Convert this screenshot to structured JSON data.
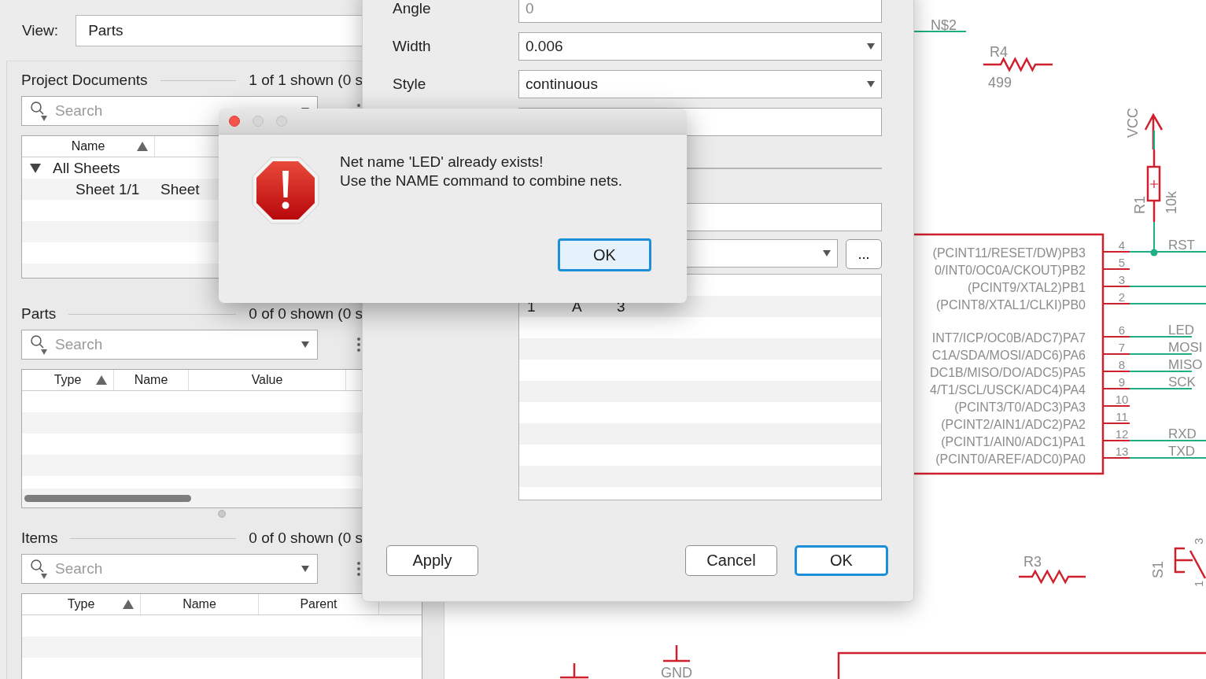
{
  "left_panel": {
    "view_label": "View:",
    "view_value": "Parts",
    "sections": [
      {
        "title": "Project Documents",
        "count": "1 of 1 shown (0 s",
        "search_placeholder": "Search",
        "columns": [
          {
            "label": "Name",
            "sorted": true
          }
        ],
        "tree": [
          {
            "label": "All Sheets",
            "expanded": true,
            "children": [
              {
                "label": "Sheet 1/1",
                "type": "Sheet"
              }
            ]
          }
        ]
      },
      {
        "title": "Parts",
        "count": "0 of 0 shown (0 s",
        "search_placeholder": "Search",
        "columns": [
          {
            "label": "Type",
            "sorted": true
          },
          {
            "label": "Name",
            "sorted": false
          },
          {
            "label": "Value",
            "sorted": false
          }
        ]
      },
      {
        "title": "Items",
        "count": "0 of 0 shown (0 s",
        "search_placeholder": "Search",
        "columns": [
          {
            "label": "Type",
            "sorted": true
          },
          {
            "label": "Name",
            "sorted": false
          },
          {
            "label": "Parent",
            "sorted": false
          }
        ]
      }
    ]
  },
  "properties_dialog": {
    "fields": [
      {
        "label": "Angle",
        "kind": "text",
        "placeholder": "0"
      },
      {
        "label": "Width",
        "kind": "dropdown",
        "value": "0.006"
      },
      {
        "label": "Style",
        "kind": "dropdown",
        "value": "continuous"
      },
      {
        "kind": "text"
      }
    ],
    "lower_fields": [
      {
        "kind": "text"
      },
      {
        "kind": "dropdown_with_button",
        "button": "..."
      }
    ],
    "list": {
      "rows": [
        {
          "cells": [
            "1",
            "A",
            "3"
          ]
        }
      ]
    },
    "buttons": [
      {
        "label": "Apply",
        "default": false
      },
      {
        "label": "Cancel",
        "default": false
      },
      {
        "label": "OK",
        "default": true
      }
    ]
  },
  "alert": {
    "message": "Net name 'LED' already exists!\nUse the NAME command to combine nets.",
    "button": {
      "label": "OK",
      "default": true
    }
  },
  "schematic": {
    "net_label": "N$2",
    "resistors": [
      {
        "name": "R4",
        "value": "499"
      },
      {
        "name": "R1",
        "value": "10k"
      },
      {
        "name": "R3"
      }
    ],
    "supplies": [
      {
        "name": "VCC"
      },
      {
        "name": "GND"
      }
    ],
    "chip_pins": [
      {
        "name": "(PCINT11/RESET/DW)PB3",
        "number": "4",
        "net": "RST",
        "wire": true
      },
      {
        "name": "0/INT0/OC0A/CKOUT)PB2",
        "number": "5",
        "wire": false
      },
      {
        "name": "(PCINT9/XTAL2)PB1",
        "number": "3",
        "wire": true
      },
      {
        "name": "(PCINT8/XTAL1/CLKI)PB0",
        "number": "2",
        "wire": true
      },
      {
        "name": "INT7/ICP/OC0B/ADC7)PA7",
        "number": "6",
        "net": "LED",
        "wire": true
      },
      {
        "name": "C1A/SDA/MOSI/ADC6)PA6",
        "number": "7",
        "net": "MOSI",
        "wire": true
      },
      {
        "name": "DC1B/MISO/DO/ADC5)PA5",
        "number": "8",
        "net": "MISO",
        "wire": true
      },
      {
        "name": "4/T1/SCL/USCK/ADC4)PA4",
        "number": "9",
        "net": "SCK",
        "wire": true
      },
      {
        "name": "(PCINT3/T0/ADC3)PA3",
        "number": "10",
        "wire": false
      },
      {
        "name": "(PCINT2/AIN1/ADC2)PA2",
        "number": "11",
        "wire": false
      },
      {
        "name": "(PCINT1/AIN0/ADC1)PA1",
        "number": "12",
        "net": "RXD",
        "wire": true
      },
      {
        "name": "(PCINT0/AREF/ADC0)PA0",
        "number": "13",
        "net": "TXD",
        "wire": true
      }
    ],
    "switch": {
      "name": "S1",
      "pins": [
        "3",
        "1"
      ]
    }
  }
}
